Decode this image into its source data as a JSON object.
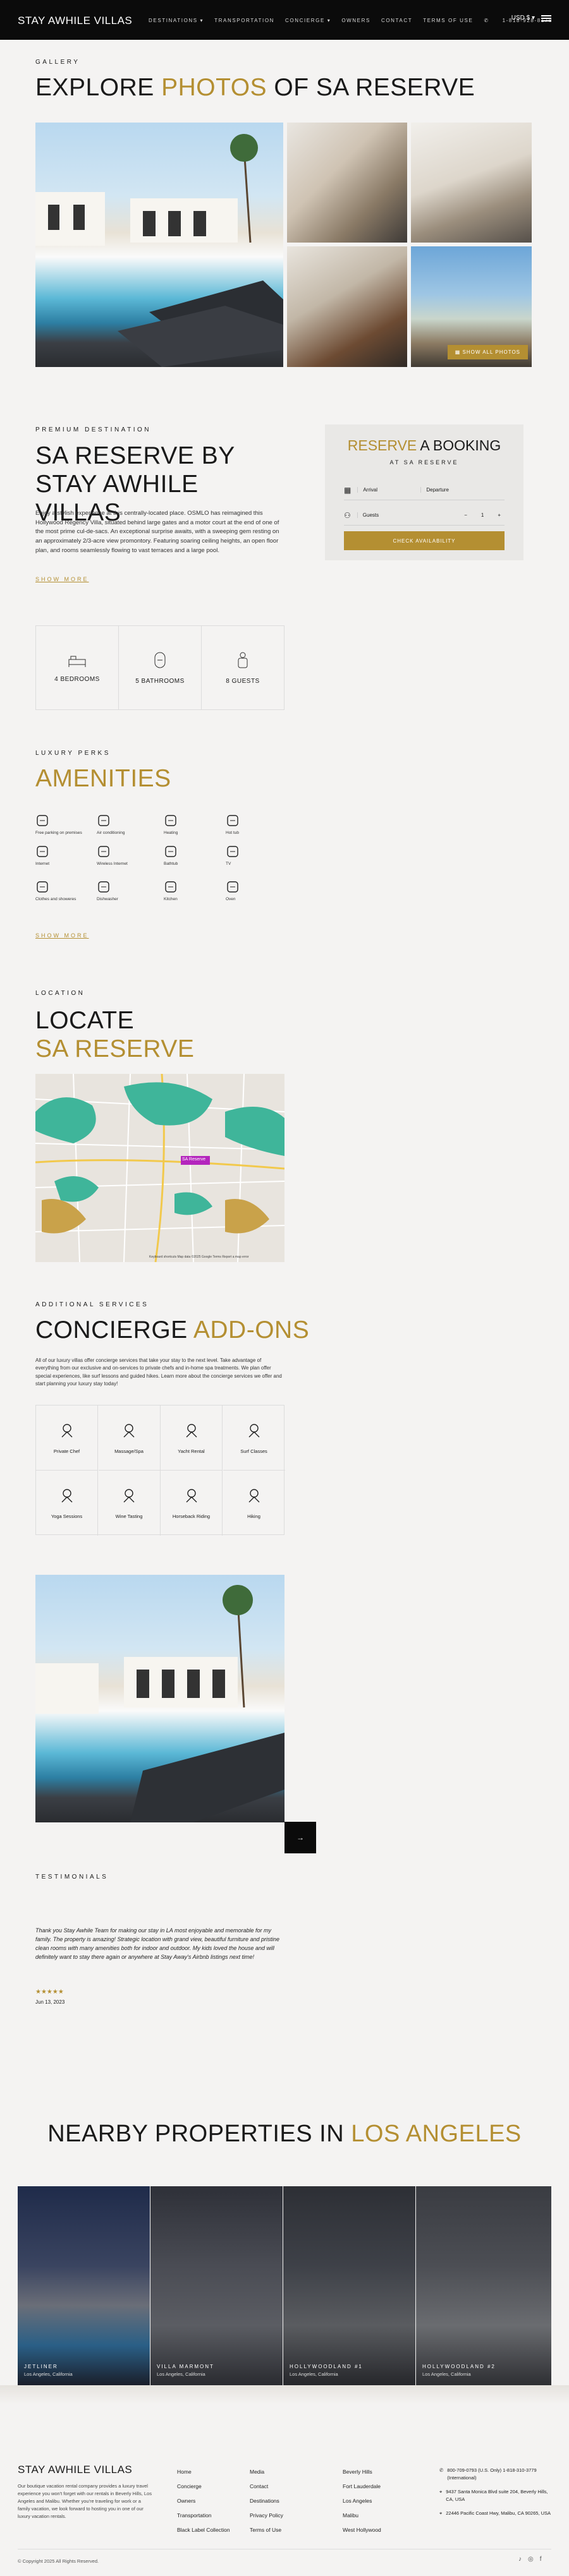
{
  "header": {
    "brand": "STAY AWHILE VILLAS",
    "nav": [
      "DESTINATIONS ▾",
      "TRANSPORTATION",
      "CONCIERGE ▾",
      "OWNERS",
      "CONTACT",
      "TERMS OF USE"
    ],
    "phone": "1-818-928-8178",
    "currency": "USD $ ▾"
  },
  "gallery": {
    "eyebrow": "GALLERY",
    "title_a": "EXPLORE ",
    "title_b": "PHOTOS",
    "title_c": " OF SA RESERVE",
    "show_all": "SHOW ALL PHOTOS"
  },
  "intro": {
    "eyebrow": "PREMIUM DESTINATION",
    "title": "SA RESERVE BY STAY AWHILE VILLAS",
    "body": "Enjoy a stylish experience at this centrally-located place. OSMLO has reimagined this Hollywood Regency Villa, situated behind large gates and a motor court at the end of one of the most prime cul-de-sacs. An exceptional surprise awaits, with a sweeping gem resting on an approximately 2/3-acre view promontory. Featuring soaring ceiling heights, an open floor plan, and rooms seamlessly flowing to vast terraces and a large pool.",
    "show_more": "SHOW MORE"
  },
  "booking": {
    "title_a": "RESERVE",
    "title_b": " A BOOKING",
    "subtitle": "AT SA RESERVE",
    "arrival": "Arrival",
    "departure": "Departure",
    "guests": "Guests",
    "guest_count": "1",
    "minus": "−",
    "plus": "+",
    "cta": "CHECK AVAILABILITY"
  },
  "stats": [
    {
      "icon": "bed-icon",
      "label": "4 BEDROOMS"
    },
    {
      "icon": "bathtub-icon",
      "label": "5 BATHROOMS"
    },
    {
      "icon": "guests-icon",
      "label": "8 GUESTS"
    }
  ],
  "amenities": {
    "eyebrow": "LUXURY PERKS",
    "title": "AMENITIES",
    "items": [
      {
        "icon": "parking-icon",
        "label": "Free parking on premises"
      },
      {
        "icon": "air-conditioning-icon",
        "label": "Air conditioning"
      },
      {
        "icon": "heating-icon",
        "label": "Heating"
      },
      {
        "icon": "hot-tub-icon",
        "label": "Hot tub"
      },
      {
        "icon": "internet-icon",
        "label": "Internet"
      },
      {
        "icon": "wireless-internet-icon",
        "label": "Wireless Internet"
      },
      {
        "icon": "bathtub-icon",
        "label": "Bathtub"
      },
      {
        "icon": "tv-icon",
        "label": "TV"
      },
      {
        "icon": "washer-icon",
        "label": "Clothes and showeres"
      },
      {
        "icon": "dishwasher-icon",
        "label": "Dishwasher"
      },
      {
        "icon": "kitchen-icon",
        "label": "Kitchen"
      },
      {
        "icon": "oven-icon",
        "label": "Oven"
      }
    ],
    "show_more": "SHOW MORE"
  },
  "location": {
    "eyebrow": "LOCATION",
    "title_a": "LOCATE",
    "title_b": "SA RESERVE",
    "pin": "SA Reserve",
    "attribution": "Keyboard shortcuts   Map data ©2025 Google   Terms   Report a map error"
  },
  "concierge": {
    "eyebrow": "ADDITIONAL SERVICES",
    "title_a": "CONCIERGE ",
    "title_b": "ADD-ONS",
    "body": "All of our luxury villas offer concierge services that take your stay to the next level. Take advantage of everything from our exclusive and on-services to private chefs and in-home spa treatments. We plan offer special experiences, like surf lessons and guided hikes. Learn more about the concierge services we offer and start planning your luxury stay today!",
    "items": [
      {
        "icon": "chef-hat-icon",
        "label": "Private Chef"
      },
      {
        "icon": "massage-icon",
        "label": "Massage/Spa"
      },
      {
        "icon": "yacht-icon",
        "label": "Yacht Rental"
      },
      {
        "icon": "surf-icon",
        "label": "Surf Classes"
      },
      {
        "icon": "yoga-icon",
        "label": "Yoga Sessions"
      },
      {
        "icon": "wine-glass-icon",
        "label": "Wine Tasting"
      },
      {
        "icon": "horse-icon",
        "label": "Horseback Riding"
      },
      {
        "icon": "hiking-icon",
        "label": "Hiking"
      }
    ]
  },
  "testimonials": {
    "eyebrow": "TESTIMONIALS",
    "quote": "Thank you Stay Awhile Team for making our stay in LA most enjoyable and memorable for my family. The property is amazing! Strategic location with grand view, beautiful furniture and pristine clean rooms with many amenities both for indoor and outdoor. My kids loved the house and will definitely want to stay there again or anywhere at Stay Away's Airbnb listings next time!",
    "stars": "★★★★★",
    "date": "Jun 13, 2023"
  },
  "nearby": {
    "title_a": "NEARBY PROPERTIES IN ",
    "title_b": "LOS ANGELES",
    "cards": [
      {
        "name": "JETLINER",
        "location": "Los Angeles, California"
      },
      {
        "name": "VILLA MARMONT",
        "location": "Los Angeles, California"
      },
      {
        "name": "HOLLYWOODLAND #1",
        "location": "Los Angeles, California"
      },
      {
        "name": "HOLLYWOODLAND #2",
        "location": "Los Angeles, California"
      }
    ]
  },
  "footer": {
    "brand": "STAY AWHILE VILLAS",
    "about": "Our boutique vacation rental company provides a luxury travel experience you won't forget with our rentals in Beverly Hills, Los Angeles and Malibu. Whether you're traveling for work or a family vacation, we look forward to hosting you in one of our luxury vacation rentals.",
    "col1": [
      "Home",
      "Concierge",
      "Owners",
      "Transportation",
      "Black Label Collection"
    ],
    "col2": [
      "Media",
      "Contact",
      "Destinations",
      "Privacy Policy",
      "Terms of Use"
    ],
    "col3": [
      "Beverly Hills",
      "Fort Lauderdale",
      "Los Angeles",
      "Malibu",
      "West Hollywood"
    ],
    "contact": [
      {
        "icon": "phone-icon",
        "text": "800-709-0793 (U.S. Only) 1-818-310-3779 (International)"
      },
      {
        "icon": "location-icon",
        "text": "9437 Santa Monica Blvd suite 204, Beverly Hills, CA, USA"
      },
      {
        "icon": "location-icon",
        "text": "22446 Pacific Coast Hwy, Malibu, CA 90265, USA"
      }
    ],
    "copyright": "© Copyright 2025 All Rights Reserved."
  }
}
